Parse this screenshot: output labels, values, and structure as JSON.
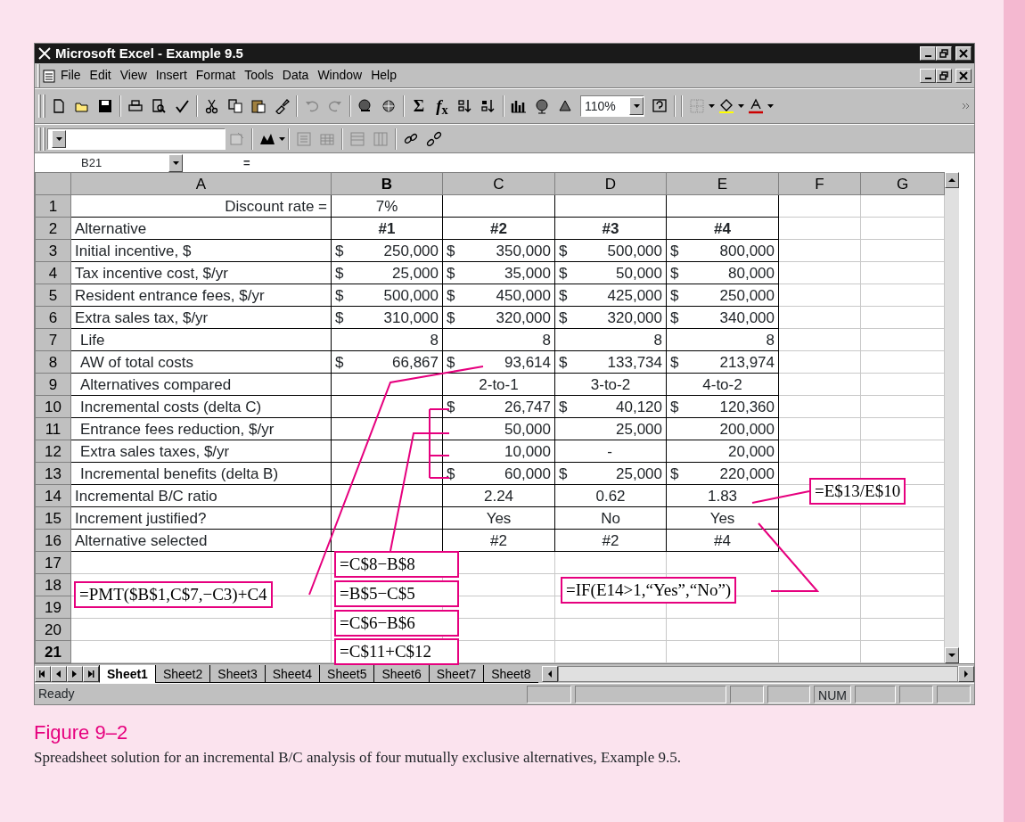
{
  "window": {
    "title": "Microsoft Excel - Example 9.5"
  },
  "menu": [
    "File",
    "Edit",
    "View",
    "Insert",
    "Format",
    "Tools",
    "Data",
    "Window",
    "Help"
  ],
  "standard_toolbar": {
    "sum_symbol": "Σ",
    "function_symbol": "*f*$_{x}$",
    "zoom": "110%"
  },
  "formula_bar": {
    "name_box": "B21",
    "equals": "="
  },
  "sheet": {
    "columns": [
      {
        "label": "A",
        "selected": false
      },
      {
        "label": "B",
        "selected": true
      },
      {
        "label": "C",
        "selected": false
      },
      {
        "label": "D",
        "selected": false
      },
      {
        "label": "E",
        "selected": false
      },
      {
        "label": "F",
        "selected": false
      },
      {
        "label": "G",
        "selected": false
      }
    ],
    "rows": [
      {
        "number": "1",
        "selected": false,
        "cells": {
          "A": {
            "kind": "right",
            "text": "Discount rate ="
          },
          "B": {
            "kind": "center",
            "text": "7%"
          }
        }
      },
      {
        "number": "2",
        "selected": false,
        "cells": {
          "A": {
            "kind": "left",
            "text": "Alternative"
          },
          "B": {
            "kind": "heading",
            "text": "#1"
          },
          "C": {
            "kind": "heading",
            "text": "#2"
          },
          "D": {
            "kind": "heading",
            "text": "#3"
          },
          "E": {
            "kind": "heading",
            "text": "#4"
          }
        }
      },
      {
        "number": "3",
        "selected": false,
        "cells": {
          "A": {
            "kind": "left",
            "text": "Initial incentive, $"
          },
          "B": {
            "kind": "money",
            "currency": "$",
            "text": "250,000"
          },
          "C": {
            "kind": "money",
            "currency": "$",
            "text": "350,000"
          },
          "D": {
            "kind": "money",
            "currency": "$",
            "text": "500,000"
          },
          "E": {
            "kind": "money",
            "currency": "$",
            "text": "800,000"
          }
        }
      },
      {
        "number": "4",
        "selected": false,
        "cells": {
          "A": {
            "kind": "left",
            "text": "Tax incentive cost, $/yr"
          },
          "B": {
            "kind": "money",
            "currency": "$",
            "text": "25,000"
          },
          "C": {
            "kind": "money",
            "currency": "$",
            "text": "35,000"
          },
          "D": {
            "kind": "money",
            "currency": "$",
            "text": "50,000"
          },
          "E": {
            "kind": "money",
            "currency": "$",
            "text": "80,000"
          }
        }
      },
      {
        "number": "5",
        "selected": false,
        "cells": {
          "A": {
            "kind": "left",
            "text": "Resident entrance fees, $/yr"
          },
          "B": {
            "kind": "money",
            "currency": "$",
            "text": "500,000"
          },
          "C": {
            "kind": "money",
            "currency": "$",
            "text": "450,000"
          },
          "D": {
            "kind": "money",
            "currency": "$",
            "text": "425,000"
          },
          "E": {
            "kind": "money",
            "currency": "$",
            "text": "250,000"
          }
        }
      },
      {
        "number": "6",
        "selected": false,
        "cells": {
          "A": {
            "kind": "left",
            "text": "Extra sales tax, $/yr"
          },
          "B": {
            "kind": "money",
            "currency": "$",
            "text": "310,000"
          },
          "C": {
            "kind": "money",
            "currency": "$",
            "text": "320,000"
          },
          "D": {
            "kind": "money",
            "currency": "$",
            "text": "320,000"
          },
          "E": {
            "kind": "money",
            "currency": "$",
            "text": "340,000"
          }
        }
      },
      {
        "number": "7",
        "selected": false,
        "cells": {
          "A": {
            "kind": "indent",
            "text": "Life"
          },
          "B": {
            "kind": "right",
            "text": "8"
          },
          "C": {
            "kind": "right",
            "text": "8"
          },
          "D": {
            "kind": "right",
            "text": "8"
          },
          "E": {
            "kind": "right",
            "text": "8"
          }
        }
      },
      {
        "number": "8",
        "selected": false,
        "cells": {
          "A": {
            "kind": "indent",
            "text": "AW of total costs"
          },
          "B": {
            "kind": "money",
            "currency": "$",
            "text": "66,867"
          },
          "C": {
            "kind": "money",
            "currency": "$",
            "text": "93,614"
          },
          "D": {
            "kind": "money",
            "currency": "$",
            "text": "133,734"
          },
          "E": {
            "kind": "money",
            "currency": "$",
            "text": "213,974"
          }
        }
      },
      {
        "number": "9",
        "selected": false,
        "cells": {
          "A": {
            "kind": "indent",
            "text": "Alternatives compared"
          },
          "C": {
            "kind": "center",
            "text": "2-to-1"
          },
          "D": {
            "kind": "center",
            "text": "3-to-2"
          },
          "E": {
            "kind": "center",
            "text": "4-to-2"
          }
        }
      },
      {
        "number": "10",
        "selected": false,
        "cells": {
          "A": {
            "kind": "indent",
            "text": "Incremental costs (delta C)"
          },
          "C": {
            "kind": "money",
            "currency": "$",
            "text": "26,747"
          },
          "D": {
            "kind": "money",
            "currency": "$",
            "text": "40,120"
          },
          "E": {
            "kind": "money",
            "currency": "$",
            "text": "120,360"
          }
        }
      },
      {
        "number": "11",
        "selected": false,
        "cells": {
          "A": {
            "kind": "indent",
            "text": "Entrance fees reduction, $/yr"
          },
          "C": {
            "kind": "money",
            "text": "50,000"
          },
          "D": {
            "kind": "money",
            "text": "25,000"
          },
          "E": {
            "kind": "money",
            "text": "200,000"
          }
        }
      },
      {
        "number": "12",
        "selected": false,
        "cells": {
          "A": {
            "kind": "indent",
            "text": "Extra sales taxes, $/yr"
          },
          "C": {
            "kind": "money",
            "text": "10,000"
          },
          "D": {
            "kind": "dash",
            "text": "-"
          },
          "E": {
            "kind": "money",
            "text": "20,000"
          }
        }
      },
      {
        "number": "13",
        "selected": false,
        "cells": {
          "A": {
            "kind": "indent",
            "text": "Incremental benefits (delta B)"
          },
          "C": {
            "kind": "money",
            "currency": "$",
            "text": "60,000"
          },
          "D": {
            "kind": "money",
            "currency": "$",
            "text": "25,000"
          },
          "E": {
            "kind": "money",
            "currency": "$",
            "text": "220,000"
          }
        }
      },
      {
        "number": "14",
        "selected": false,
        "cells": {
          "A": {
            "kind": "left",
            "text": "Incremental B/C ratio"
          },
          "C": {
            "kind": "center",
            "text": "2.24"
          },
          "D": {
            "kind": "center",
            "text": "0.62"
          },
          "E": {
            "kind": "center",
            "text": "1.83"
          }
        }
      },
      {
        "number": "15",
        "selected": false,
        "cells": {
          "A": {
            "kind": "left",
            "text": "Increment justified?"
          },
          "C": {
            "kind": "center",
            "text": "Yes"
          },
          "D": {
            "kind": "center",
            "text": "No"
          },
          "E": {
            "kind": "center",
            "text": "Yes"
          }
        }
      },
      {
        "number": "16",
        "selected": false,
        "cells": {
          "A": {
            "kind": "left",
            "text": "Alternative selected"
          },
          "C": {
            "kind": "center",
            "text": "#2"
          },
          "D": {
            "kind": "center",
            "text": "#2"
          },
          "E": {
            "kind": "center",
            "text": "#4"
          }
        }
      },
      {
        "number": "17",
        "selected": false,
        "cells": {}
      },
      {
        "number": "18",
        "selected": false,
        "cells": {}
      },
      {
        "number": "19",
        "selected": false,
        "cells": {}
      },
      {
        "number": "20",
        "selected": false,
        "cells": {}
      },
      {
        "number": "21",
        "selected": true,
        "cells": {}
      }
    ]
  },
  "callouts": [
    "=PMT($B$1,C$7,−C3)+C4",
    "=C$8−B$8",
    "=B$5−C$5",
    "=C$6−B$6",
    "=C$11+C$12",
    "=IF(E14>1,“Yes”,“No”)",
    "=E$13/E$10"
  ],
  "sheet_tabs": [
    {
      "label": "Sheet1",
      "selected": true
    },
    {
      "label": "Sheet2",
      "selected": false
    },
    {
      "label": "Sheet3",
      "selected": false
    },
    {
      "label": "Sheet4",
      "selected": false
    },
    {
      "label": "Sheet5",
      "selected": false
    },
    {
      "label": "Sheet6",
      "selected": false
    },
    {
      "label": "Sheet7",
      "selected": false
    },
    {
      "label": "Sheet8",
      "selected": false
    }
  ],
  "status_bar": {
    "message": "Ready",
    "indicator": "NUM"
  },
  "figure": {
    "label": "Figure 9–2",
    "caption": "Spreadsheet solution for an incremental B/C analysis of four mutually exclusive alternatives, Example 9.5."
  }
}
